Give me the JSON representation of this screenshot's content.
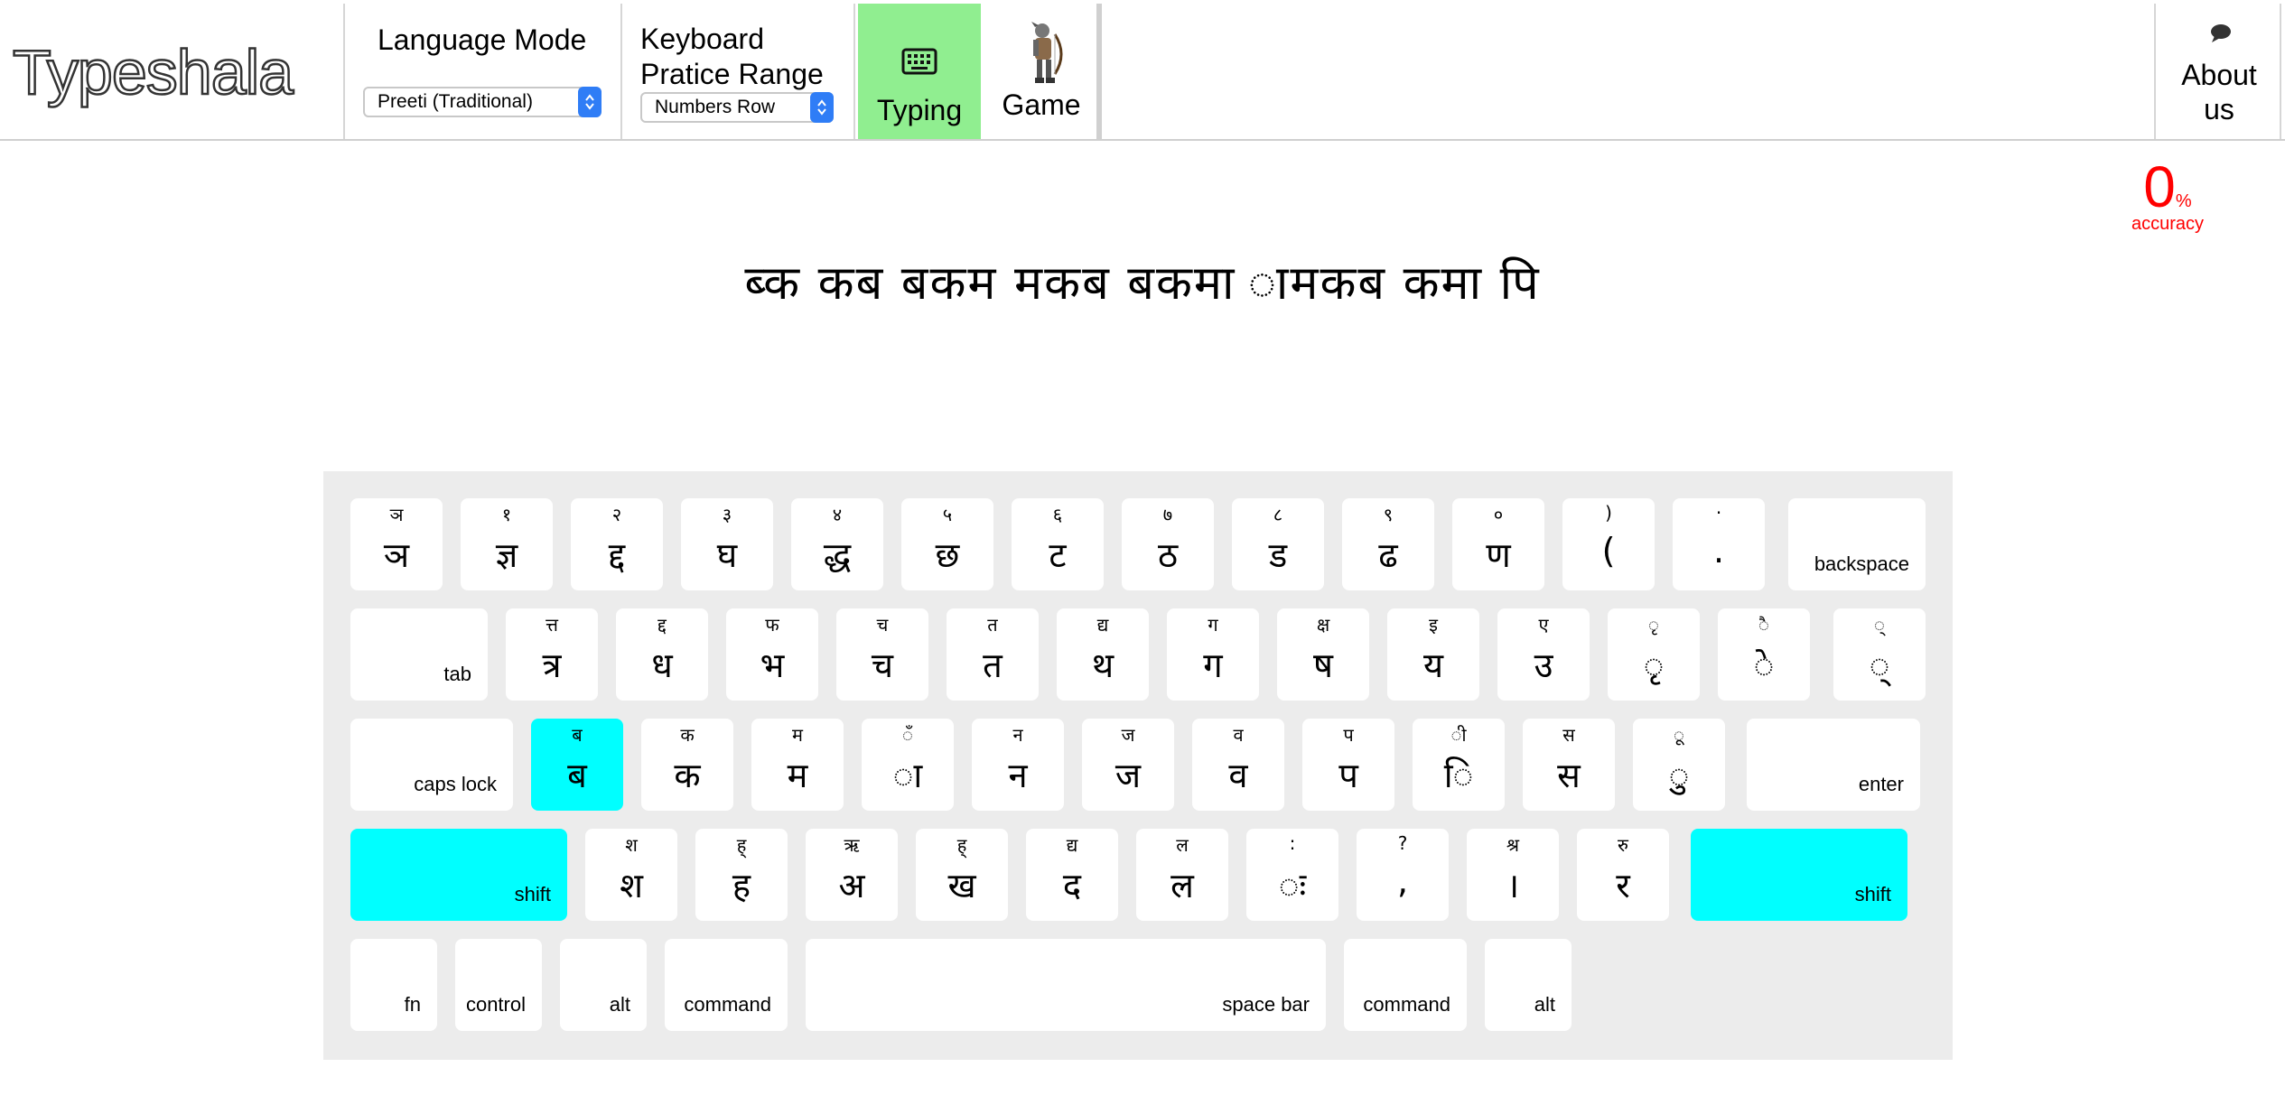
{
  "brand": "Typeshala",
  "language_mode": {
    "title": "Language Mode",
    "selected": "Preeti (Traditional)"
  },
  "practice_range": {
    "title_line1": "Keyboard",
    "title_line2": "Pratice Range",
    "selected": "Numbers Row"
  },
  "nav": {
    "typing": "Typing",
    "game": "Game",
    "about_line1": "About",
    "about_line2": "us"
  },
  "accuracy": {
    "value": "0",
    "unit": "%",
    "label": "accuracy"
  },
  "practice_text": "ब्क कब बकम मकब बकमा ामकब कमा पि",
  "colors": {
    "active_key": "#00ffff",
    "active_tab": "#90ee90",
    "accuracy": "#ff0000"
  },
  "keyboard": {
    "row1": [
      {
        "top": "ञ",
        "main": "ञ"
      },
      {
        "top": "१",
        "main": "ज्ञ"
      },
      {
        "top": "२",
        "main": "द्द"
      },
      {
        "top": "३",
        "main": "घ"
      },
      {
        "top": "४",
        "main": "द्ध"
      },
      {
        "top": "५",
        "main": "छ"
      },
      {
        "top": "६",
        "main": "ट"
      },
      {
        "top": "७",
        "main": "ठ"
      },
      {
        "top": "८",
        "main": "ड"
      },
      {
        "top": "९",
        "main": "ढ"
      },
      {
        "top": "०",
        "main": "ण"
      },
      {
        "top": ")",
        "main": "("
      },
      {
        "top": "·",
        "main": "."
      }
    ],
    "backspace": "backspace",
    "tab": "tab",
    "row2": [
      {
        "top": "त्त",
        "main": "त्र"
      },
      {
        "top": "द्द",
        "main": "ध"
      },
      {
        "top": "फ",
        "main": "भ"
      },
      {
        "top": "च",
        "main": "च"
      },
      {
        "top": "त",
        "main": "त"
      },
      {
        "top": "द्य",
        "main": "थ"
      },
      {
        "top": "ग",
        "main": "ग"
      },
      {
        "top": "क्ष",
        "main": "ष"
      },
      {
        "top": "इ",
        "main": "य"
      },
      {
        "top": "ए",
        "main": "उ"
      },
      {
        "top": "ृ",
        "main": "ृ"
      },
      {
        "top": "ै",
        "main": "े"
      },
      {
        "top": "्",
        "main": "्"
      }
    ],
    "capslock": "caps lock",
    "row3": [
      {
        "top": "ब",
        "main": "ब",
        "active": true
      },
      {
        "top": "क",
        "main": "क"
      },
      {
        "top": "म",
        "main": "म"
      },
      {
        "top": "ँ",
        "main": "ा"
      },
      {
        "top": "न",
        "main": "न"
      },
      {
        "top": "ज",
        "main": "ज"
      },
      {
        "top": "व",
        "main": "व"
      },
      {
        "top": "प",
        "main": "प"
      },
      {
        "top": "ी",
        "main": "ि"
      },
      {
        "top": "स",
        "main": "स"
      },
      {
        "top": "ू",
        "main": "ु"
      }
    ],
    "enter": "enter",
    "shift": "shift",
    "row4": [
      {
        "top": "श",
        "main": "श"
      },
      {
        "top": "ह्",
        "main": "ह"
      },
      {
        "top": "ऋ",
        "main": "अ"
      },
      {
        "top": "ह्",
        "main": "ख"
      },
      {
        "top": "द्य",
        "main": "द"
      },
      {
        "top": "ल",
        "main": "ल"
      },
      {
        "top": ":",
        "main": "ः"
      },
      {
        "top": "?",
        "main": ","
      },
      {
        "top": "श्र",
        "main": "।"
      },
      {
        "top": "रु",
        "main": "र"
      }
    ],
    "bottom": {
      "fn": "fn",
      "control": "control",
      "alt": "alt",
      "command": "command",
      "space": "space bar"
    }
  }
}
